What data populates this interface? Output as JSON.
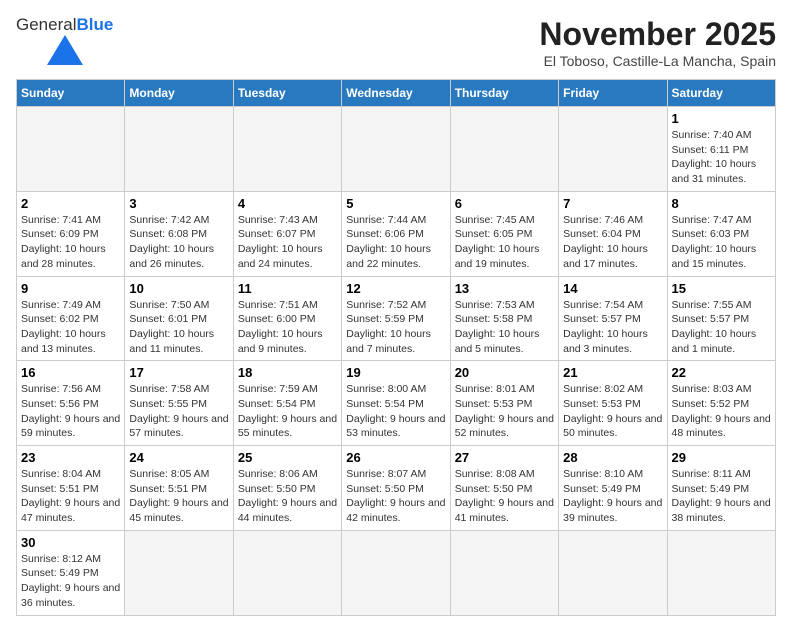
{
  "header": {
    "logo_text_normal": "General",
    "logo_text_blue": "Blue",
    "month_title": "November 2025",
    "subtitle": "El Toboso, Castille-La Mancha, Spain"
  },
  "calendar": {
    "days_of_week": [
      "Sunday",
      "Monday",
      "Tuesday",
      "Wednesday",
      "Thursday",
      "Friday",
      "Saturday"
    ],
    "weeks": [
      [
        {
          "day": "",
          "info": ""
        },
        {
          "day": "",
          "info": ""
        },
        {
          "day": "",
          "info": ""
        },
        {
          "day": "",
          "info": ""
        },
        {
          "day": "",
          "info": ""
        },
        {
          "day": "",
          "info": ""
        },
        {
          "day": "1",
          "info": "Sunrise: 7:40 AM\nSunset: 6:11 PM\nDaylight: 10 hours and 31 minutes."
        }
      ],
      [
        {
          "day": "2",
          "info": "Sunrise: 7:41 AM\nSunset: 6:09 PM\nDaylight: 10 hours and 28 minutes."
        },
        {
          "day": "3",
          "info": "Sunrise: 7:42 AM\nSunset: 6:08 PM\nDaylight: 10 hours and 26 minutes."
        },
        {
          "day": "4",
          "info": "Sunrise: 7:43 AM\nSunset: 6:07 PM\nDaylight: 10 hours and 24 minutes."
        },
        {
          "day": "5",
          "info": "Sunrise: 7:44 AM\nSunset: 6:06 PM\nDaylight: 10 hours and 22 minutes."
        },
        {
          "day": "6",
          "info": "Sunrise: 7:45 AM\nSunset: 6:05 PM\nDaylight: 10 hours and 19 minutes."
        },
        {
          "day": "7",
          "info": "Sunrise: 7:46 AM\nSunset: 6:04 PM\nDaylight: 10 hours and 17 minutes."
        },
        {
          "day": "8",
          "info": "Sunrise: 7:47 AM\nSunset: 6:03 PM\nDaylight: 10 hours and 15 minutes."
        }
      ],
      [
        {
          "day": "9",
          "info": "Sunrise: 7:49 AM\nSunset: 6:02 PM\nDaylight: 10 hours and 13 minutes."
        },
        {
          "day": "10",
          "info": "Sunrise: 7:50 AM\nSunset: 6:01 PM\nDaylight: 10 hours and 11 minutes."
        },
        {
          "day": "11",
          "info": "Sunrise: 7:51 AM\nSunset: 6:00 PM\nDaylight: 10 hours and 9 minutes."
        },
        {
          "day": "12",
          "info": "Sunrise: 7:52 AM\nSunset: 5:59 PM\nDaylight: 10 hours and 7 minutes."
        },
        {
          "day": "13",
          "info": "Sunrise: 7:53 AM\nSunset: 5:58 PM\nDaylight: 10 hours and 5 minutes."
        },
        {
          "day": "14",
          "info": "Sunrise: 7:54 AM\nSunset: 5:57 PM\nDaylight: 10 hours and 3 minutes."
        },
        {
          "day": "15",
          "info": "Sunrise: 7:55 AM\nSunset: 5:57 PM\nDaylight: 10 hours and 1 minute."
        }
      ],
      [
        {
          "day": "16",
          "info": "Sunrise: 7:56 AM\nSunset: 5:56 PM\nDaylight: 9 hours and 59 minutes."
        },
        {
          "day": "17",
          "info": "Sunrise: 7:58 AM\nSunset: 5:55 PM\nDaylight: 9 hours and 57 minutes."
        },
        {
          "day": "18",
          "info": "Sunrise: 7:59 AM\nSunset: 5:54 PM\nDaylight: 9 hours and 55 minutes."
        },
        {
          "day": "19",
          "info": "Sunrise: 8:00 AM\nSunset: 5:54 PM\nDaylight: 9 hours and 53 minutes."
        },
        {
          "day": "20",
          "info": "Sunrise: 8:01 AM\nSunset: 5:53 PM\nDaylight: 9 hours and 52 minutes."
        },
        {
          "day": "21",
          "info": "Sunrise: 8:02 AM\nSunset: 5:53 PM\nDaylight: 9 hours and 50 minutes."
        },
        {
          "day": "22",
          "info": "Sunrise: 8:03 AM\nSunset: 5:52 PM\nDaylight: 9 hours and 48 minutes."
        }
      ],
      [
        {
          "day": "23",
          "info": "Sunrise: 8:04 AM\nSunset: 5:51 PM\nDaylight: 9 hours and 47 minutes."
        },
        {
          "day": "24",
          "info": "Sunrise: 8:05 AM\nSunset: 5:51 PM\nDaylight: 9 hours and 45 minutes."
        },
        {
          "day": "25",
          "info": "Sunrise: 8:06 AM\nSunset: 5:50 PM\nDaylight: 9 hours and 44 minutes."
        },
        {
          "day": "26",
          "info": "Sunrise: 8:07 AM\nSunset: 5:50 PM\nDaylight: 9 hours and 42 minutes."
        },
        {
          "day": "27",
          "info": "Sunrise: 8:08 AM\nSunset: 5:50 PM\nDaylight: 9 hours and 41 minutes."
        },
        {
          "day": "28",
          "info": "Sunrise: 8:10 AM\nSunset: 5:49 PM\nDaylight: 9 hours and 39 minutes."
        },
        {
          "day": "29",
          "info": "Sunrise: 8:11 AM\nSunset: 5:49 PM\nDaylight: 9 hours and 38 minutes."
        }
      ],
      [
        {
          "day": "30",
          "info": "Sunrise: 8:12 AM\nSunset: 5:49 PM\nDaylight: 9 hours and 36 minutes."
        },
        {
          "day": "",
          "info": ""
        },
        {
          "day": "",
          "info": ""
        },
        {
          "day": "",
          "info": ""
        },
        {
          "day": "",
          "info": ""
        },
        {
          "day": "",
          "info": ""
        },
        {
          "day": "",
          "info": ""
        }
      ]
    ]
  }
}
